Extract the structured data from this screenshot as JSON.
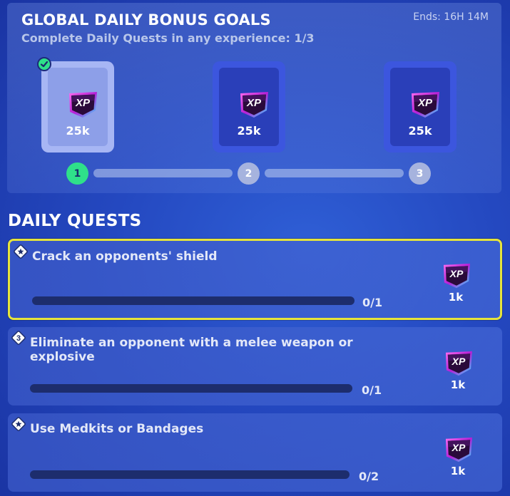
{
  "bonus_goals": {
    "title": "GLOBAL DAILY BONUS GOALS",
    "subtitle": "Complete Daily Quests in any experience: 1/3",
    "timer": "Ends: 16H 14M",
    "rewards": [
      {
        "label": "XP",
        "amount": "25k",
        "claimed": true
      },
      {
        "label": "XP",
        "amount": "25k",
        "claimed": false
      },
      {
        "label": "XP",
        "amount": "25k",
        "claimed": false
      }
    ],
    "steps": [
      "1",
      "2",
      "3"
    ],
    "completed_steps": 1
  },
  "daily_quests": {
    "title": "DAILY QUESTS",
    "quests": [
      {
        "name": "Crack an opponents' shield",
        "progress": "0/1",
        "progress_fraction": 0,
        "reward_label": "XP",
        "reward_amount": "1k",
        "selected": true,
        "icon": "star-diamond-icon"
      },
      {
        "name": "Eliminate an opponent with a melee weapon or explosive",
        "progress": "0/1",
        "progress_fraction": 0,
        "reward_label": "XP",
        "reward_amount": "1k",
        "selected": false,
        "icon": "stage-3-diamond-icon",
        "icon_text": "3"
      },
      {
        "name": "Use Medkits or Bandages",
        "progress": "0/2",
        "progress_fraction": 0,
        "reward_label": "XP",
        "reward_amount": "1k",
        "selected": false,
        "icon": "star-diamond-icon"
      }
    ]
  },
  "colors": {
    "accent_green": "#2fe08a",
    "selection_yellow": "#e6e43b",
    "xp_purple": "#b61fd6",
    "background_blue": "#2448c0"
  }
}
